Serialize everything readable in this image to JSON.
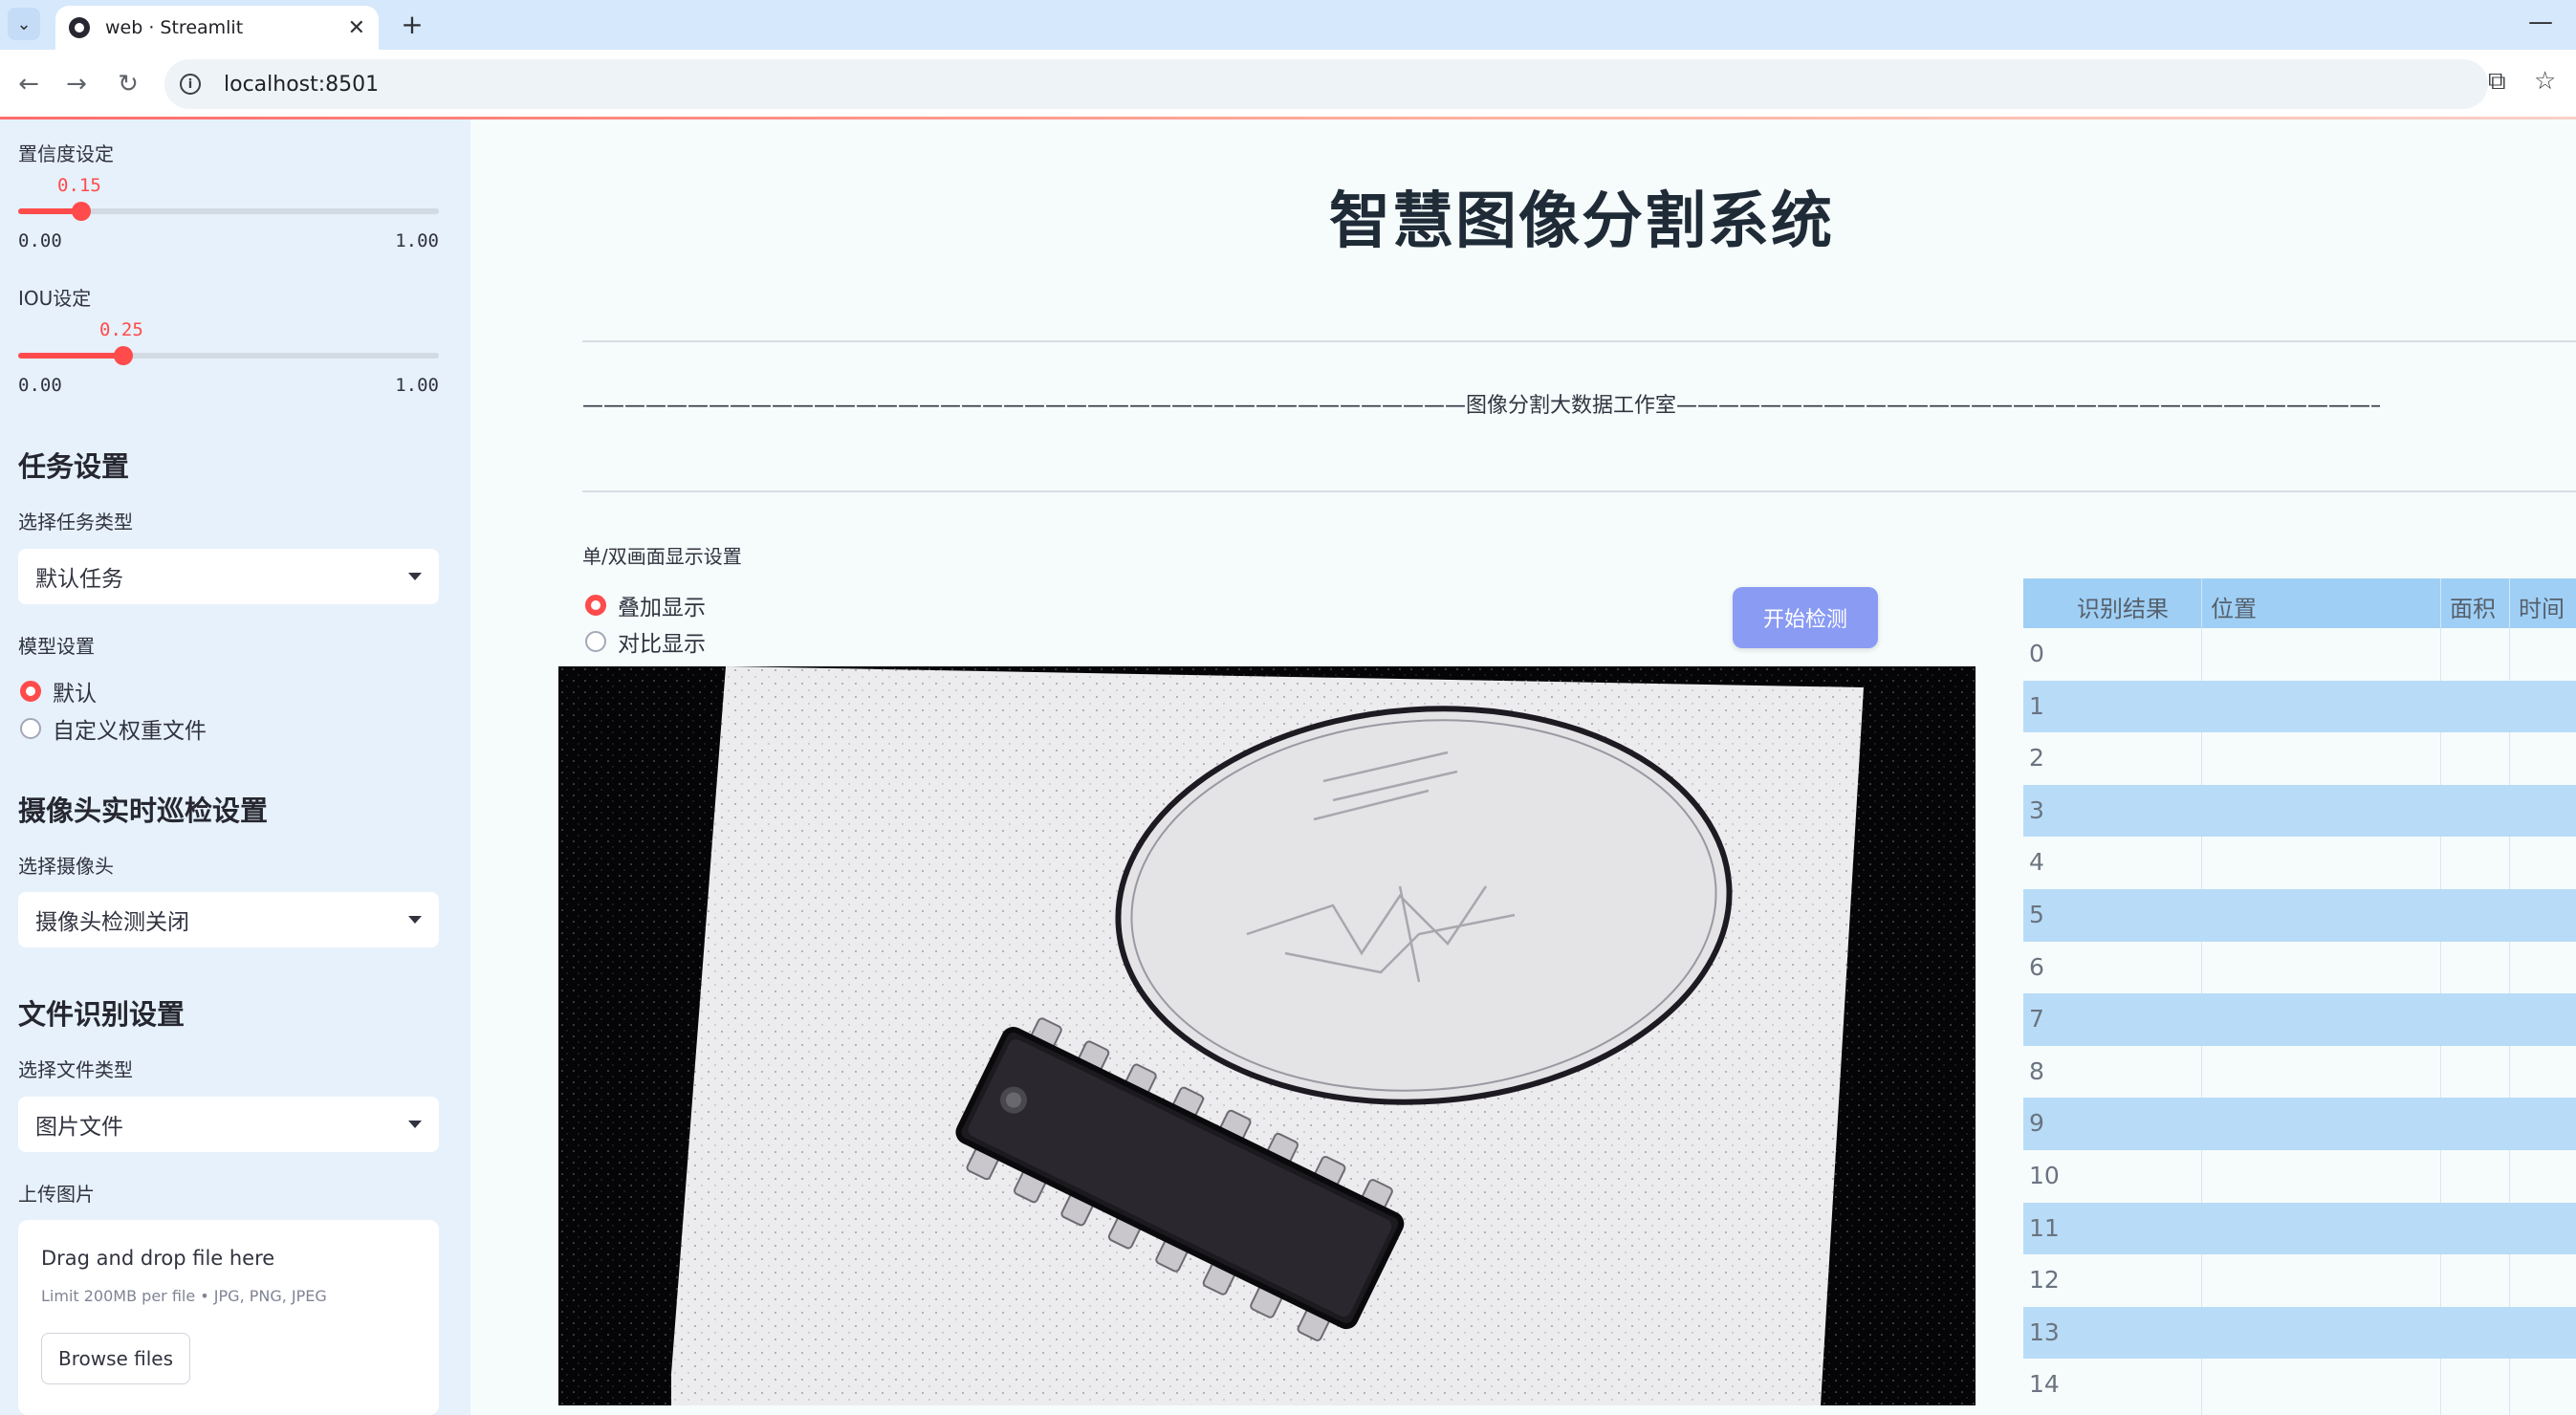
{
  "browser": {
    "tab_title": "web · Streamlit",
    "url": "localhost:8501"
  },
  "sidebar": {
    "confidence": {
      "label": "置信度设定",
      "value": "0.15",
      "value_num": 0.15,
      "min": "0.00",
      "max": "1.00"
    },
    "iou": {
      "label": "IOU设定",
      "value": "0.25",
      "value_num": 0.25,
      "min": "0.00",
      "max": "1.00"
    },
    "task": {
      "heading": "任务设置",
      "label": "选择任务类型",
      "selected": "默认任务"
    },
    "model": {
      "label": "模型设置",
      "options": [
        "默认",
        "自定义权重文件"
      ],
      "selected_index": 0
    },
    "camera": {
      "heading": "摄像头实时巡检设置",
      "label": "选择摄像头",
      "selected": "摄像头检测关闭"
    },
    "file": {
      "heading": "文件识别设置",
      "label": "选择文件类型",
      "selected": "图片文件"
    },
    "upload": {
      "label": "上传图片",
      "drop_text": "Drag and drop file here",
      "limit_text": "Limit 200MB per file • JPG, PNG, JPEG",
      "browse_label": "Browse files"
    }
  },
  "main": {
    "title": "智慧图像分割系统",
    "banner": "——————————————————————————————————————————图像分割大数据工作室——————————————————————————————————————————",
    "display_setting": {
      "label": "单/双画面显示设置",
      "options": [
        "叠加显示",
        "对比显示"
      ],
      "selected_index": 0
    },
    "detect_button": "开始检测"
  },
  "results_table": {
    "columns": [
      "识别结果",
      "位置",
      "面积",
      "时间"
    ],
    "row_indices": [
      "0",
      "1",
      "2",
      "3",
      "4",
      "5",
      "6",
      "7",
      "8",
      "9",
      "10",
      "11",
      "12",
      "13",
      "14"
    ]
  },
  "colors": {
    "accent": "#ff4b4b",
    "button": "#8a9bf4",
    "sidebar_bg": "#e6f1fb",
    "table_header": "#9fcff5",
    "table_alt_row": "#b8dcf7"
  }
}
